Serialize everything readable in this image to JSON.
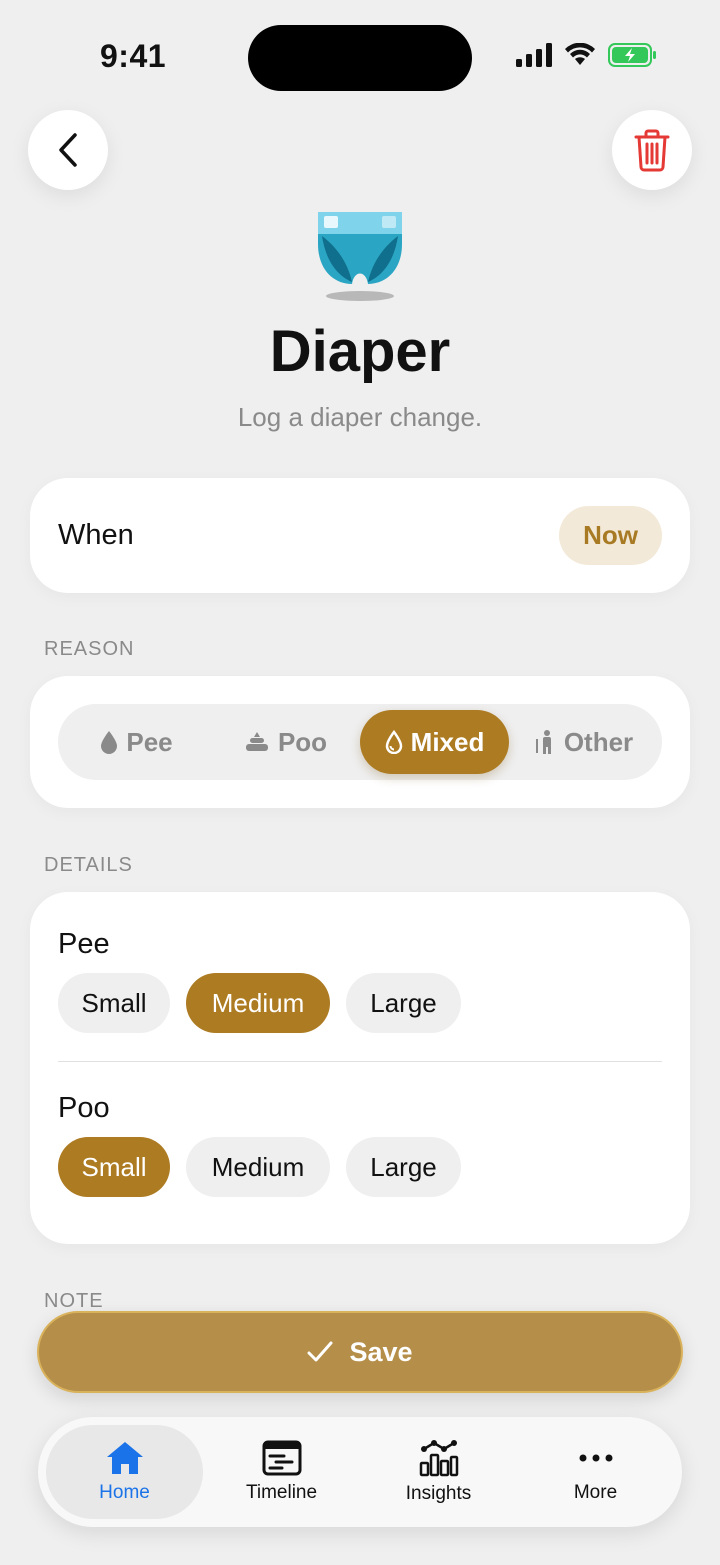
{
  "status": {
    "time": "9:41"
  },
  "header": {
    "title": "Diaper",
    "subtitle": "Log a diaper change."
  },
  "when": {
    "label": "When",
    "value": "Now"
  },
  "reason": {
    "section_label": "REASON",
    "options": [
      {
        "label": "Pee",
        "icon": "droplet-icon"
      },
      {
        "label": "Poo",
        "icon": "poop-icon"
      },
      {
        "label": "Mixed",
        "icon": "droplet-outline-icon"
      },
      {
        "label": "Other",
        "icon": "person-icon"
      }
    ],
    "selected": "Mixed"
  },
  "details": {
    "section_label": "DETAILS",
    "groups": [
      {
        "title": "Pee",
        "options": [
          "Small",
          "Medium",
          "Large"
        ],
        "selected": "Medium"
      },
      {
        "title": "Poo",
        "options": [
          "Small",
          "Medium",
          "Large"
        ],
        "selected": "Small"
      }
    ]
  },
  "note": {
    "section_label": "NOTE"
  },
  "save": {
    "label": "Save"
  },
  "tabs": [
    {
      "label": "Home",
      "icon": "home-icon"
    },
    {
      "label": "Timeline",
      "icon": "timeline-icon"
    },
    {
      "label": "Insights",
      "icon": "insights-icon"
    },
    {
      "label": "More",
      "icon": "more-icon"
    }
  ],
  "colors": {
    "accent": "#ad7b22",
    "danger": "#e53935",
    "tab_active": "#1a73e8"
  }
}
